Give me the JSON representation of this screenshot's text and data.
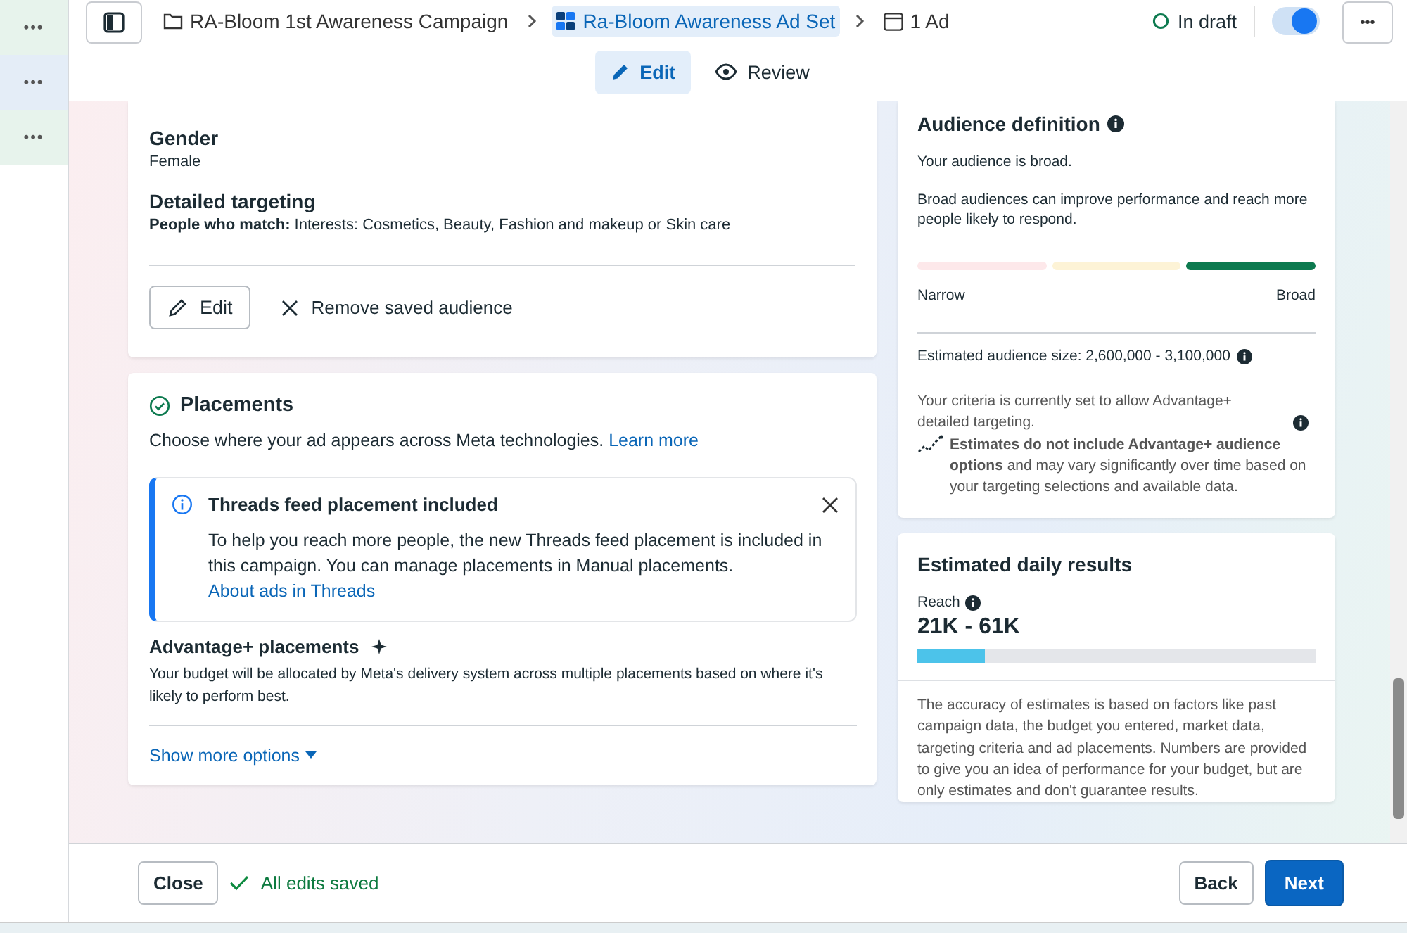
{
  "left_rail": {
    "items": [
      "•••",
      "•••",
      "•••"
    ]
  },
  "breadcrumb": [
    {
      "kind": "campaign",
      "label": "RA-Bloom 1st Awareness Campaign",
      "selected": false
    },
    {
      "kind": "adset",
      "label": "Ra-Bloom Awareness Ad Set",
      "selected": true
    },
    {
      "kind": "ad",
      "label": "1 Ad",
      "selected": false
    }
  ],
  "status": {
    "label": "In draft",
    "toggle_on": true
  },
  "more_button": "•••",
  "mode_tabs": [
    {
      "kind": "edit",
      "label": "Edit",
      "selected": true
    },
    {
      "kind": "review",
      "label": "Review",
      "selected": false
    }
  ],
  "audience_card": {
    "fields": [
      {
        "label": "Gender",
        "value": "Female"
      },
      {
        "label": "Detailed targeting",
        "value": "**People who match:** Interests: Cosmetics, Beauty, Fashion and makeup or Skin care"
      }
    ],
    "edit_button": "Edit",
    "remove_button": "Remove saved audience"
  },
  "placements_card": {
    "title": "Placements",
    "done": true,
    "description": "Choose where your ad appears across Meta technologies.",
    "learn_more": "Learn more",
    "notice": {
      "title": "Threads feed placement included",
      "body": "To help you reach more people, the new Threads feed placement is included in this campaign. You can manage placements in Manual placements.",
      "link": "About ads in Threads"
    },
    "advantage_title": "Advantage+ placements",
    "advantage_text": "Your budget will be allocated by Meta's delivery system across multiple placements based on where it's likely to perform best.",
    "show_more": "Show more options"
  },
  "audience_definition": {
    "title": "Audience definition",
    "summary": "Your audience is broad.",
    "detail": "Broad audiences can improve performance and reach more people likely to respond.",
    "segments": [
      {
        "selected": false
      },
      {
        "selected": false
      },
      {
        "selected": true
      }
    ],
    "low_label": "Narrow",
    "high_label": "Broad",
    "size": "Estimated audience size: 2,600,000 - 3,100,000",
    "criteria": "Your criteria is currently set to allow Advantage+ detailed targeting.",
    "estimate_note": "**Estimates do not include Advantage+ audience options** and may vary significantly over time based on your targeting selections and available data."
  },
  "daily_results": {
    "title": "Estimated daily results",
    "metric": "Reach",
    "range": "21K - 61K",
    "level": 0.17,
    "disclaimer": "The accuracy of estimates is based on factors like past campaign data, the budget you entered, market data, targeting criteria and ad placements. Numbers are provided to give you an idea of performance for your budget, but are only estimates and don't guarantee results."
  },
  "footer": {
    "close": "Close",
    "saved": "All edits saved",
    "back": "Back",
    "next": "Next"
  }
}
